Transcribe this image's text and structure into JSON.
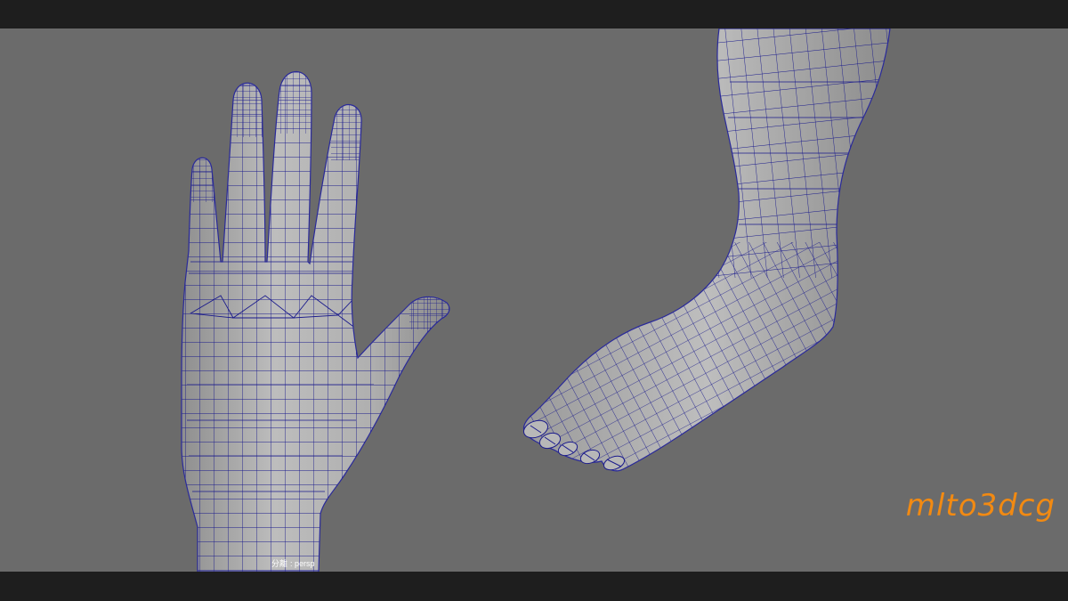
{
  "viewport": {
    "camera_label": "分離",
    "camera_name": "persp",
    "background_color": "#6b6b6b",
    "wire_color": "#1a1a8c",
    "mesh_color": "#b4b4b4"
  },
  "models": {
    "hand": "hand-mesh-icon",
    "foot": "foot-mesh-icon"
  },
  "watermark": {
    "text": "mlto3dcg",
    "color": "#f28a12"
  }
}
